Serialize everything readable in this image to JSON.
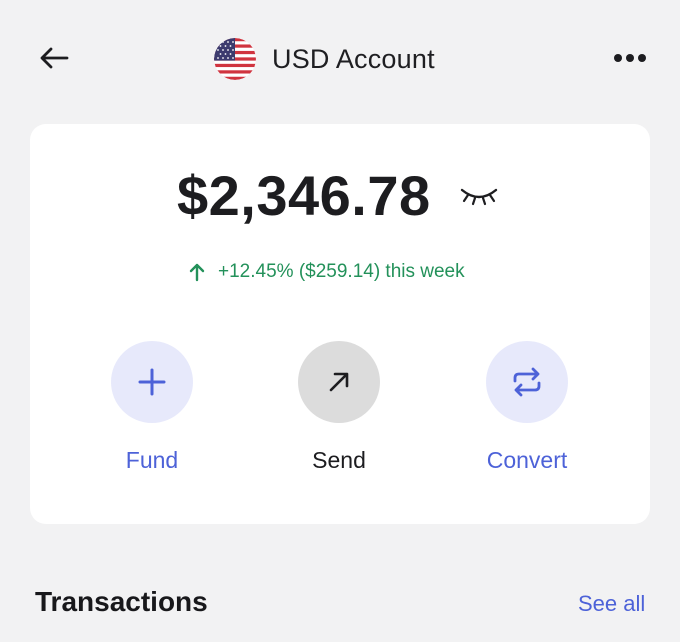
{
  "header": {
    "title": "USD Account",
    "back_icon": "arrow-left-icon",
    "flag_icon": "us-flag-icon",
    "more_icon": "more-horizontal-icon"
  },
  "balance": {
    "amount": "$2,346.78",
    "visibility_icon": "eye-closed-icon",
    "change_text": "+12.45% ($259.14) this week",
    "change_icon": "arrow-up-icon"
  },
  "actions": [
    {
      "label": "Fund",
      "icon": "plus-icon"
    },
    {
      "label": "Send",
      "icon": "arrow-up-right-icon"
    },
    {
      "label": "Convert",
      "icon": "convert-arrows-icon"
    }
  ],
  "transactions": {
    "title": "Transactions",
    "see_all": "See all"
  },
  "colors": {
    "accent": "#4d62d8",
    "positive": "#23915a",
    "accent_light": "#e7e9fb",
    "neutral_circle": "#dcdcdc",
    "background": "#f2f2f3",
    "card": "#ffffff"
  }
}
